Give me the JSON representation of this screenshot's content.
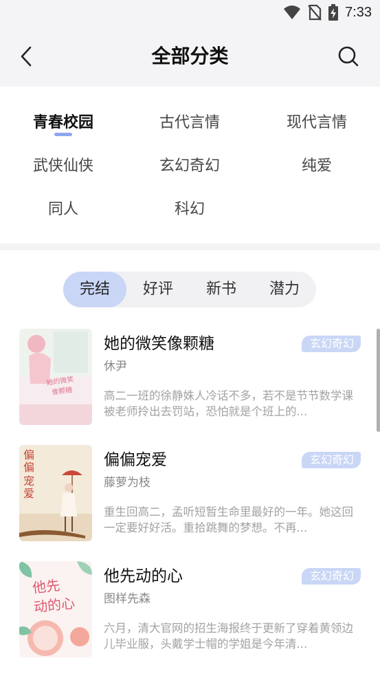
{
  "status_bar": {
    "time": "7:33",
    "icons": [
      "wifi-icon",
      "no-sim-icon",
      "battery-charging-icon"
    ]
  },
  "header": {
    "title": "全部分类",
    "back_icon": "chevron-left-icon",
    "search_icon": "search-icon"
  },
  "categories": [
    {
      "label": "青春校园",
      "active": true
    },
    {
      "label": "古代言情",
      "active": false
    },
    {
      "label": "现代言情",
      "active": false
    },
    {
      "label": "武侠仙侠",
      "active": false
    },
    {
      "label": "玄幻奇幻",
      "active": false
    },
    {
      "label": "纯爱",
      "active": false
    },
    {
      "label": "同人",
      "active": false
    },
    {
      "label": "科幻",
      "active": false
    }
  ],
  "sort_tabs": [
    {
      "label": "完结",
      "active": true
    },
    {
      "label": "好评",
      "active": false
    },
    {
      "label": "新书",
      "active": false
    },
    {
      "label": "潜力",
      "active": false
    }
  ],
  "books": [
    {
      "title": "她的微笑像颗糖",
      "author": "休尹",
      "genre": "玄幻奇幻",
      "description": "高二一班的徐静姝人冷话不多，若不是节节数学课被老师拎出去罚站，恐怕就是个班上的...",
      "cover_text": "她的微笑像颗糖"
    },
    {
      "title": "偏偏宠爱",
      "author": "藤萝为枝",
      "genre": "玄幻奇幻",
      "description": "重生回高二，孟听短暂生命里最好的一年。她这回一定要好好活。重拾跳舞的梦想。不再...",
      "cover_text": "偏偏宠爱"
    },
    {
      "title": "他先动的心",
      "author": "图样先森",
      "genre": "玄幻奇幻",
      "description": "六月，清大官网的招生海报终于更新了穿着黄领边儿毕业服，头戴学士帽的学姐是今年清...",
      "cover_text": "他先动的心"
    }
  ],
  "colors": {
    "accent": "#8fa7f0",
    "tab_active_bg": "#c9d6f6",
    "badge_bg": "#c9d6f6",
    "page_bg": "#f4f4f6"
  }
}
